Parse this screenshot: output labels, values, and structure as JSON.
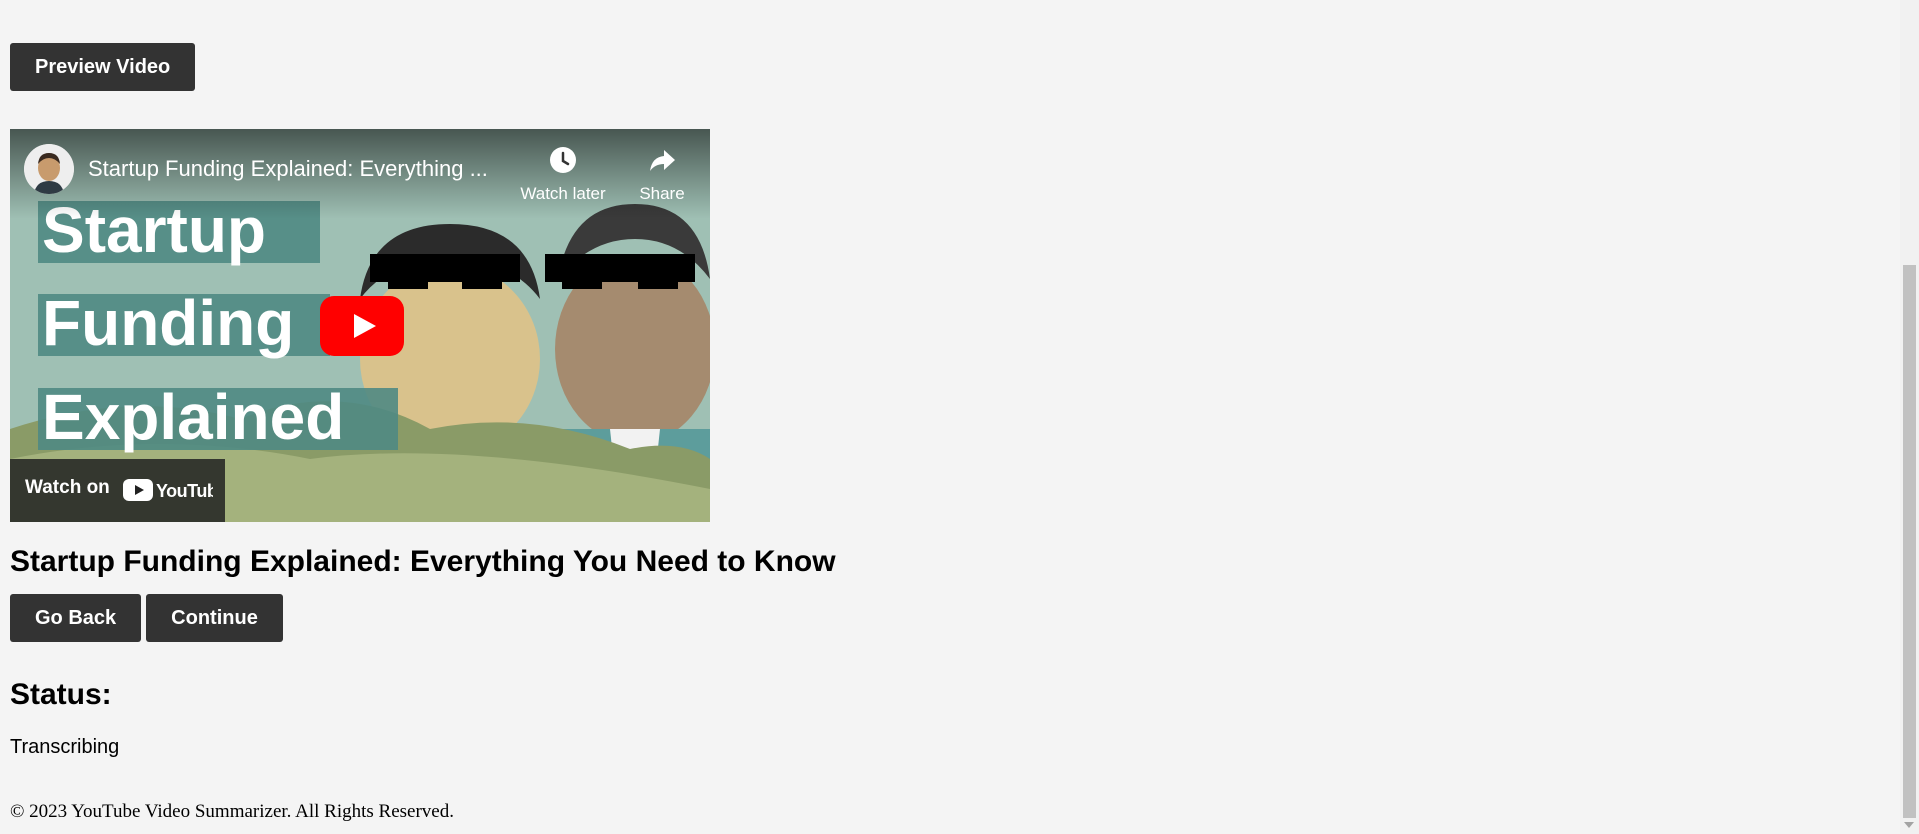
{
  "preview_button": {
    "label": "Preview Video"
  },
  "video": {
    "title": "Startup Funding Explained: Everything ...",
    "watch_later_label": "Watch later",
    "share_label": "Share",
    "watch_on_label": "Watch on",
    "youtube_brand": "YouTube",
    "thumbnail_text": [
      "Startup",
      "Funding",
      "Explained"
    ],
    "icons": {
      "watch_later": "clock-icon",
      "share": "share-arrow-icon",
      "play": "play-icon"
    },
    "colors": {
      "play": "#ff0000",
      "thumb_bg": "#9fc0b4"
    }
  },
  "main": {
    "title": "Startup Funding Explained: Everything You Need to Know"
  },
  "actions": {
    "back_label": "Go Back",
    "continue_label": "Continue"
  },
  "status": {
    "heading": "Status:",
    "value": "Transcribing"
  },
  "footer": {
    "text": "© 2023 YouTube Video Summarizer. All Rights Reserved."
  }
}
